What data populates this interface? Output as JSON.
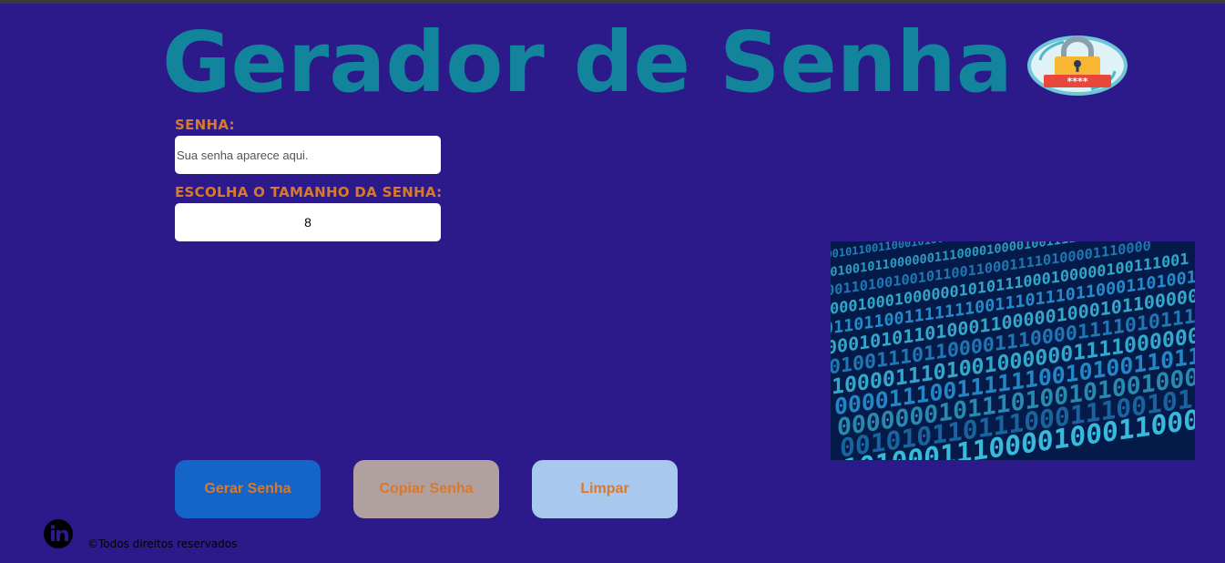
{
  "header": {
    "title": "Gerador de Senha",
    "lock_icon": "padlock-icon",
    "lock_icon_text": "****"
  },
  "form": {
    "password_label": "SENHA:",
    "password_placeholder": "Sua senha aparece aqui.",
    "password_value": "",
    "length_label": "ESCOLHA O TAMANHO DA SENHA:",
    "length_value": "8"
  },
  "side_image": {
    "name": "binary-code-image"
  },
  "buttons": {
    "generate_label": "Gerar Senha",
    "copy_label": "Copiar Senha",
    "clear_label": "Limpar"
  },
  "footer": {
    "linkedin_icon": "linkedin-icon",
    "copyright": "©Todos direitos reservados"
  },
  "colors": {
    "background": "#2d1a8a",
    "title": "#12859c",
    "label": "#d9792a",
    "generate_button": "#1565c8",
    "copy_button": "#b0a0a0",
    "clear_button": "#a8c8ee"
  }
}
